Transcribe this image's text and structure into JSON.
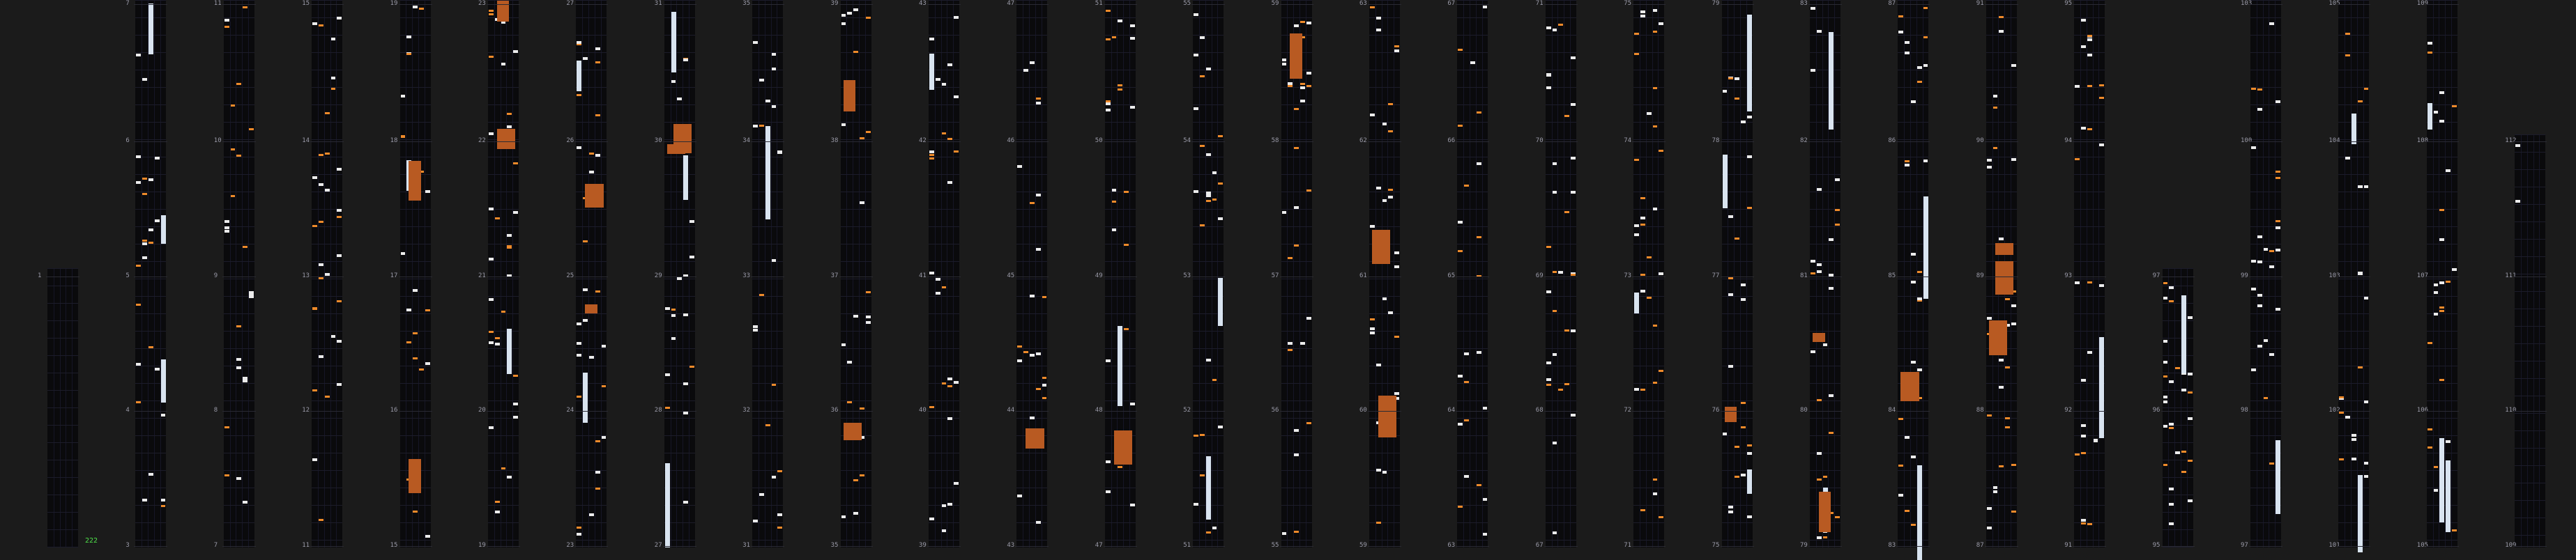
{
  "app": {
    "combo_counter": "222"
  },
  "colors": {
    "background": "#1b1b1b",
    "lane": "#0a0a0c",
    "tap_note": "#ececec",
    "orange_note": "#ee8a2a",
    "hold_bar": "#d9e4f0",
    "block": "#b85a22",
    "slide_blue": "#1e6fa6",
    "slide_magenta": "#b03a8c",
    "combo_text": "#4fe24a"
  },
  "chart_columns": [
    {
      "labels": [
        "3",
        "2",
        "1"
      ]
    },
    {
      "labels": [
        "7",
        "6",
        "5",
        "4",
        "3"
      ]
    },
    {
      "labels": [
        "11",
        "10",
        "9",
        "8",
        "7"
      ]
    },
    {
      "labels": [
        "15",
        "14",
        "13",
        "12",
        "11"
      ]
    },
    {
      "labels": [
        "19",
        "18",
        "17",
        "16",
        "15"
      ]
    },
    {
      "labels": [
        "23",
        "22",
        "21",
        "20",
        "19"
      ]
    },
    {
      "labels": [
        "27",
        "26",
        "25",
        "24",
        "23"
      ]
    },
    {
      "labels": [
        "31",
        "30",
        "29",
        "28",
        "27"
      ]
    },
    {
      "labels": [
        "35",
        "34",
        "33",
        "32",
        "31"
      ]
    },
    {
      "labels": [
        "39",
        "38",
        "37",
        "36",
        "35"
      ]
    },
    {
      "labels": [
        "43",
        "42",
        "41",
        "40",
        "39"
      ]
    },
    {
      "labels": [
        "47",
        "46",
        "45",
        "44",
        "43"
      ]
    },
    {
      "labels": [
        "51",
        "50",
        "49",
        "48",
        "47"
      ]
    },
    {
      "labels": [
        "55",
        "54",
        "53",
        "52",
        "51"
      ]
    },
    {
      "labels": [
        "59",
        "58",
        "57",
        "56",
        "55"
      ]
    },
    {
      "labels": [
        "63",
        "62",
        "61",
        "60",
        "59"
      ]
    },
    {
      "labels": [
        "67",
        "66",
        "65",
        "64",
        "63"
      ]
    },
    {
      "labels": [
        "71",
        "70",
        "69",
        "68",
        "67"
      ]
    },
    {
      "labels": [
        "75",
        "74",
        "73",
        "72",
        "71"
      ]
    },
    {
      "labels": [
        "79",
        "78",
        "77",
        "76",
        "75"
      ]
    },
    {
      "labels": [
        "83",
        "82",
        "81",
        "80",
        "79"
      ]
    },
    {
      "labels": [
        "87",
        "86",
        "85",
        "84",
        "83"
      ]
    },
    {
      "labels": [
        "91",
        "90",
        "89",
        "88",
        "87"
      ]
    },
    {
      "labels": [
        "95",
        "94",
        "93",
        "92",
        "91"
      ]
    },
    {
      "labels": [
        "",
        "",
        "97",
        "96",
        "95"
      ]
    },
    {
      "labels": [
        "103",
        "100",
        "99",
        "98",
        "97"
      ]
    },
    {
      "labels": [
        "105",
        "104",
        "103",
        "102",
        "101"
      ]
    },
    {
      "labels": [
        "109",
        "108",
        "107",
        "106",
        "105"
      ]
    },
    {
      "labels": [
        "",
        "112",
        "111",
        "110",
        "109"
      ]
    }
  ]
}
